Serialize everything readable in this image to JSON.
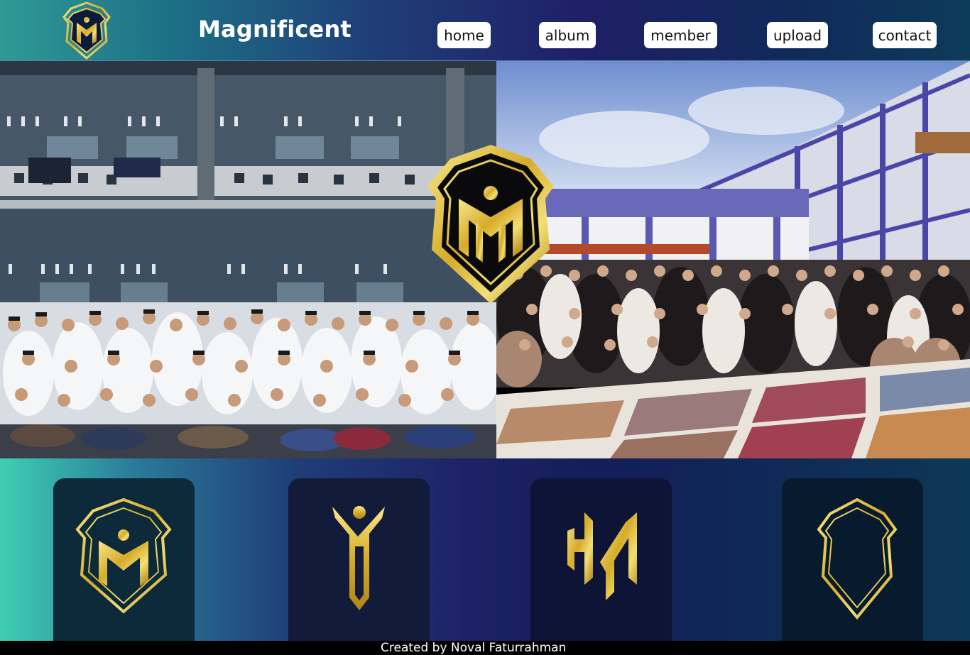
{
  "header": {
    "brand": "Magnificent",
    "logo_icon": "shield-monogram-logo-icon",
    "nav": [
      {
        "label": "home"
      },
      {
        "label": "album"
      },
      {
        "label": "member"
      },
      {
        "label": "upload"
      },
      {
        "label": "contact"
      }
    ]
  },
  "hero": {
    "left_photo": "group-photo-boys",
    "right_photo": "group-photo-girls",
    "center_logo": "shield-monogram-logo-icon"
  },
  "gallery": {
    "cards": [
      {
        "icon": "shield-monogram-logo-icon"
      },
      {
        "icon": "m-figure-icon"
      },
      {
        "icon": "hm-monogram-icon"
      },
      {
        "icon": "shield-outline-icon"
      }
    ]
  },
  "footer": {
    "credit": "Created by Noval Faturrahman"
  },
  "colors": {
    "gold": "#d9b531",
    "gold_light": "#f3df74",
    "navy": "#1d2266",
    "teal": "#3ecfb3"
  }
}
